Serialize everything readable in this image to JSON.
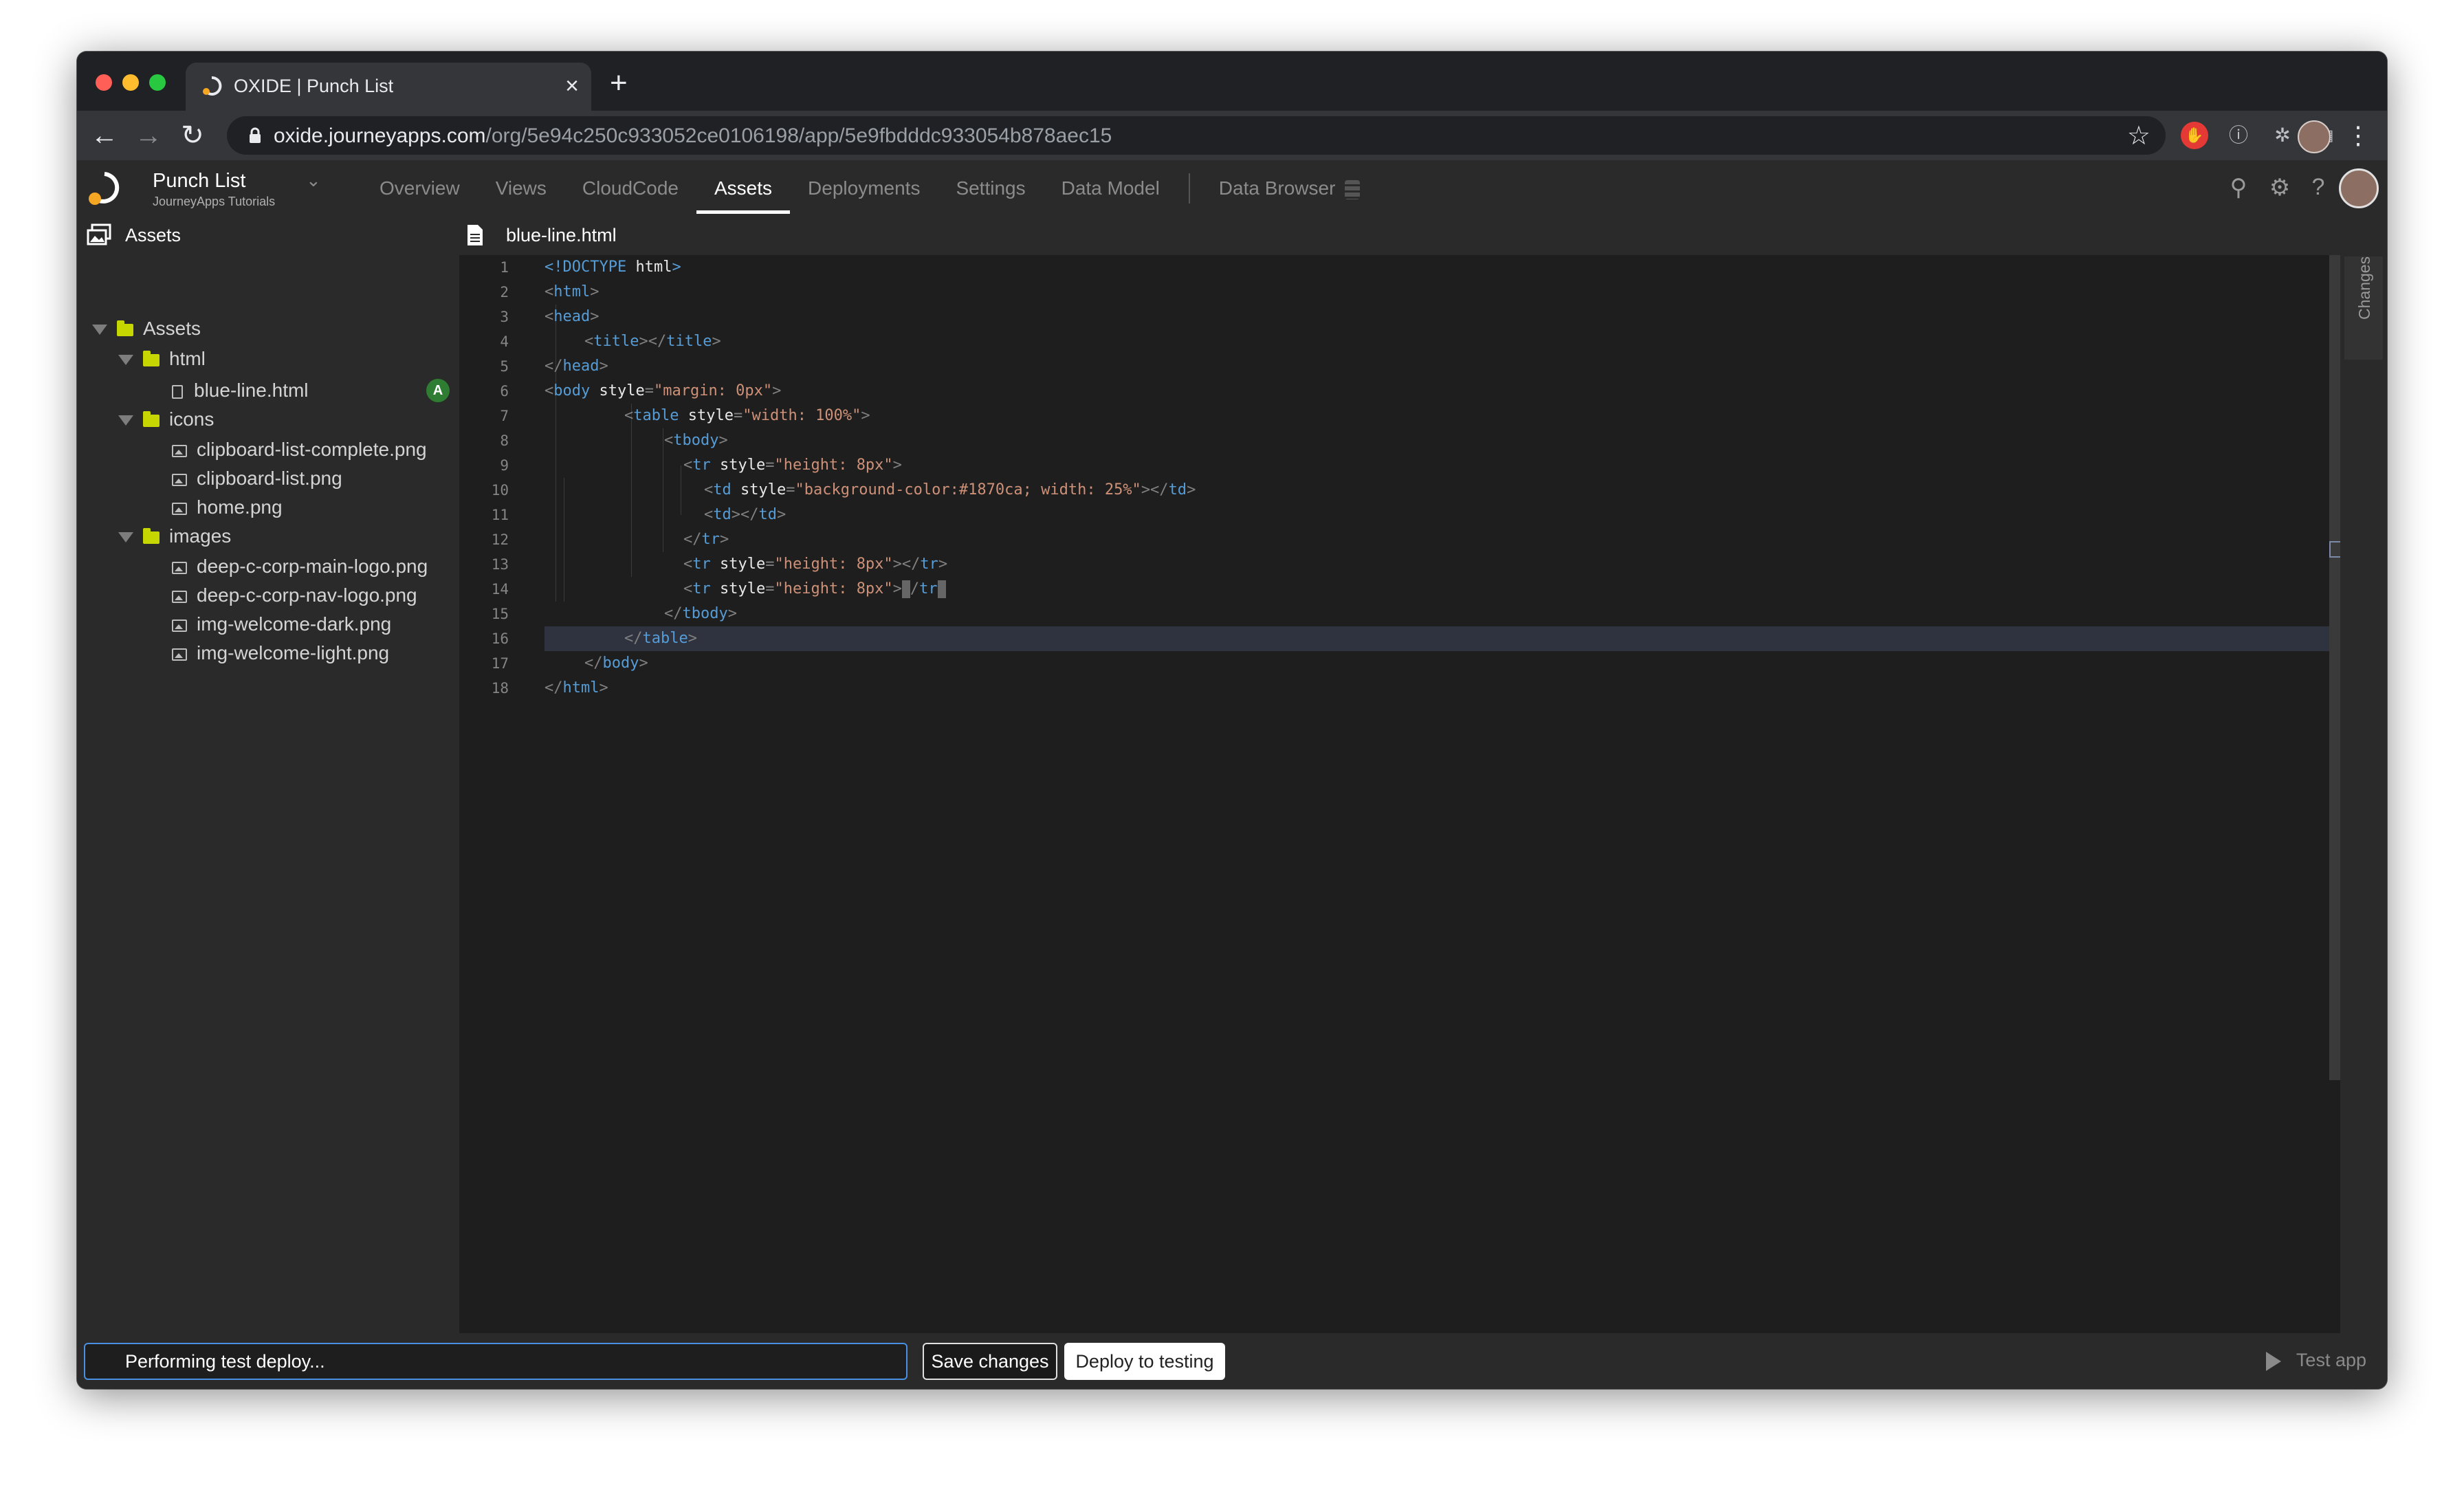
{
  "browser": {
    "tab_title": "OXIDE | Punch List",
    "tab_close": "×",
    "new_tab": "+",
    "url_host": "oxide.journeyapps.com",
    "url_path": "/org/5e94c250c933052ce0106198/app/5e9fbdddc933054b878aec15",
    "back_icon": "←",
    "forward_icon": "→",
    "reload_icon": "↻",
    "star_icon": "☆",
    "menu_icon": "⋮"
  },
  "app_header": {
    "project_name": "Punch List",
    "project_org": "JourneyApps Tutorials",
    "project_caret": "⌄",
    "tabs": [
      {
        "label": "Overview"
      },
      {
        "label": "Views"
      },
      {
        "label": "CloudCode"
      },
      {
        "label": "Assets"
      },
      {
        "label": "Deployments"
      },
      {
        "label": "Settings"
      },
      {
        "label": "Data Model"
      }
    ],
    "data_browser": "Data Browser",
    "active_tab": "Assets",
    "search_icon": "⚲",
    "settings_icon": "⚙",
    "help_icon": "?"
  },
  "panel": {
    "assets_title": "Assets",
    "open_file": "blue-line.html"
  },
  "tree": {
    "root": "Assets",
    "folders": [
      {
        "name": "html",
        "files": [
          "blue-line.html"
        ]
      },
      {
        "name": "icons",
        "files": [
          "clipboard-list-complete.png",
          "clipboard-list.png",
          "home.png"
        ]
      },
      {
        "name": "images",
        "files": [
          "deep-c-corp-main-logo.png",
          "deep-c-corp-nav-logo.png",
          "img-welcome-dark.png",
          "img-welcome-light.png"
        ]
      }
    ],
    "added_badge": "A"
  },
  "editor": {
    "line_numbers": [
      "1",
      "2",
      "3",
      "4",
      "5",
      "6",
      "7",
      "8",
      "9",
      "10",
      "11",
      "12",
      "13",
      "14",
      "15",
      "16",
      "17",
      "18"
    ],
    "code": {
      "l1": "!DOCTYPE",
      "l1b": "html",
      "html": "html",
      "head": "head",
      "title": "title",
      "body": "body",
      "style_attr": "style",
      "body_style": "\"margin: 0px\"",
      "table": "table",
      "table_style": "\"width: 100%\"",
      "tbody": "tbody",
      "tr": "tr",
      "tr_style": "\"height: 8px\"",
      "td": "td",
      "td_style": "\"background-color:#1870ca; width: 25%\""
    }
  },
  "rail": {
    "changes_label": "Changes"
  },
  "bottom": {
    "status_text": "Performing test deploy...",
    "save_label": "Save changes",
    "deploy_label": "Deploy to testing",
    "test_app_label": "Test app"
  }
}
